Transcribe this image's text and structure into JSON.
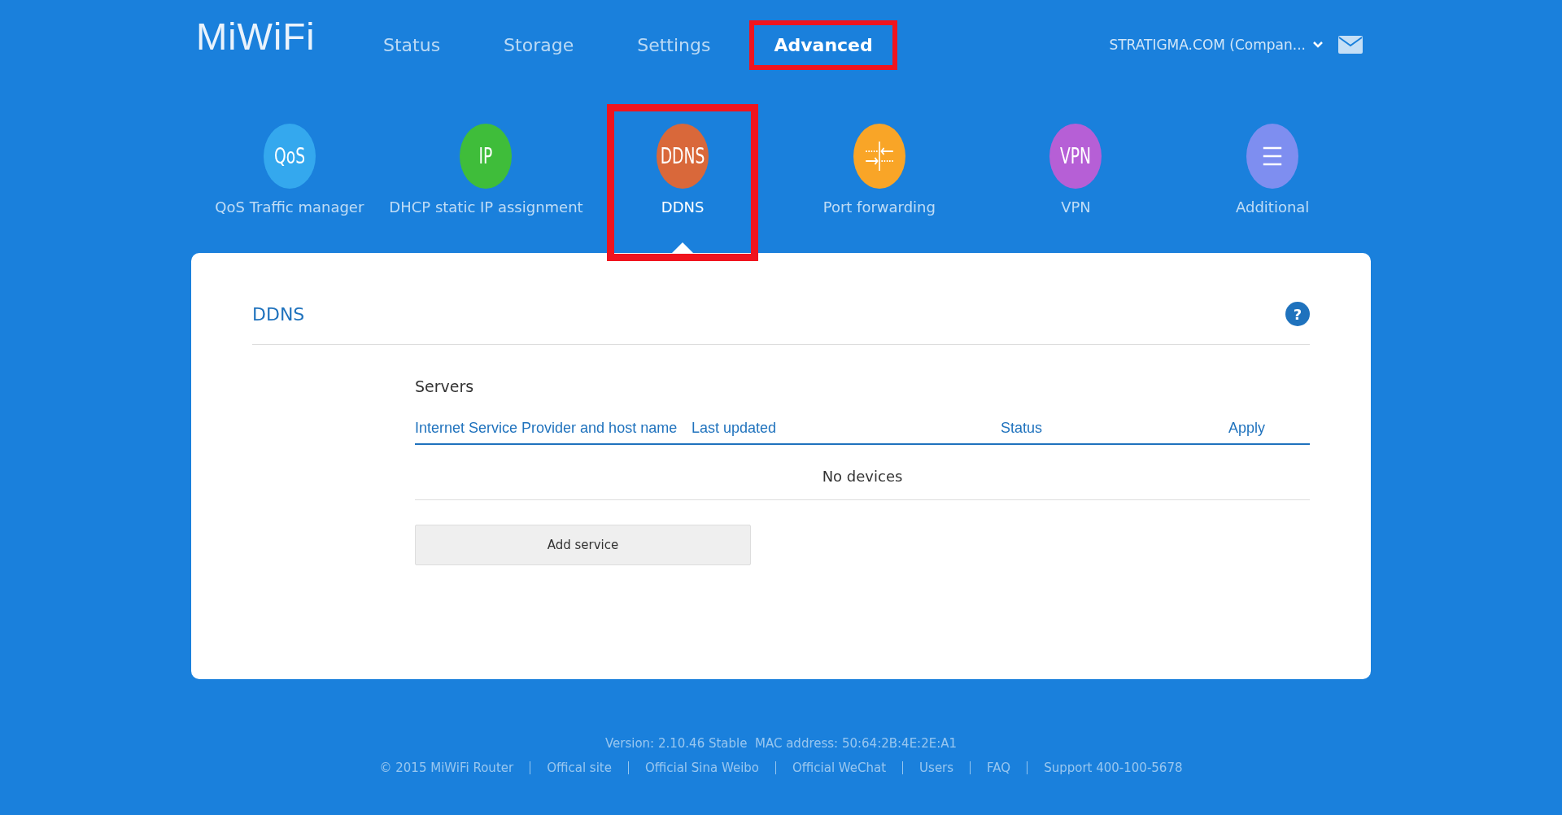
{
  "logo": "MiWiFi",
  "nav": [
    {
      "label": "Status",
      "selected": false,
      "highlighted": false
    },
    {
      "label": "Storage",
      "selected": false,
      "highlighted": false
    },
    {
      "label": "Settings",
      "selected": false,
      "highlighted": false
    },
    {
      "label": "Advanced",
      "selected": true,
      "highlighted": true
    }
  ],
  "account": {
    "label": "STRATIGMA.COM (Compan..."
  },
  "apps": [
    {
      "kind": "text",
      "icon_text": "QoS",
      "label": "QoS Traffic manager",
      "color": "#34a8ee",
      "selected": false,
      "highlighted": false
    },
    {
      "kind": "text",
      "icon_text": "IP",
      "label": "DHCP static IP assignment",
      "color": "#3fbd3a",
      "selected": false,
      "highlighted": false
    },
    {
      "kind": "text",
      "icon_text": "DDNS",
      "label": "DDNS",
      "color": "#d9683a",
      "selected": true,
      "highlighted": true
    },
    {
      "kind": "ports",
      "label": "Port forwarding",
      "color": "#f9a527",
      "selected": false,
      "highlighted": false
    },
    {
      "kind": "text",
      "icon_text": "VPN",
      "label": "VPN",
      "color": "#b65fd6",
      "selected": false,
      "highlighted": false
    },
    {
      "kind": "menu",
      "label": "Additional",
      "color": "#7e8ef0",
      "selected": false,
      "highlighted": false
    }
  ],
  "panel": {
    "title": "DDNS",
    "help": "?",
    "section": "Servers",
    "table": {
      "columns": [
        "Internet Service Provider and host name",
        "Last updated",
        "Status",
        "Apply"
      ],
      "empty": "No devices"
    },
    "button": "Add service"
  },
  "footer": {
    "version": "Version: 2.10.46 Stable  MAC address: 50:64:2B:4E:2E:A1",
    "links": [
      "© 2015 MiWiFi Router",
      "Offical site",
      "Official Sina Weibo",
      "Official WeChat",
      "Users",
      "FAQ",
      "Support 400-100-5678"
    ]
  }
}
